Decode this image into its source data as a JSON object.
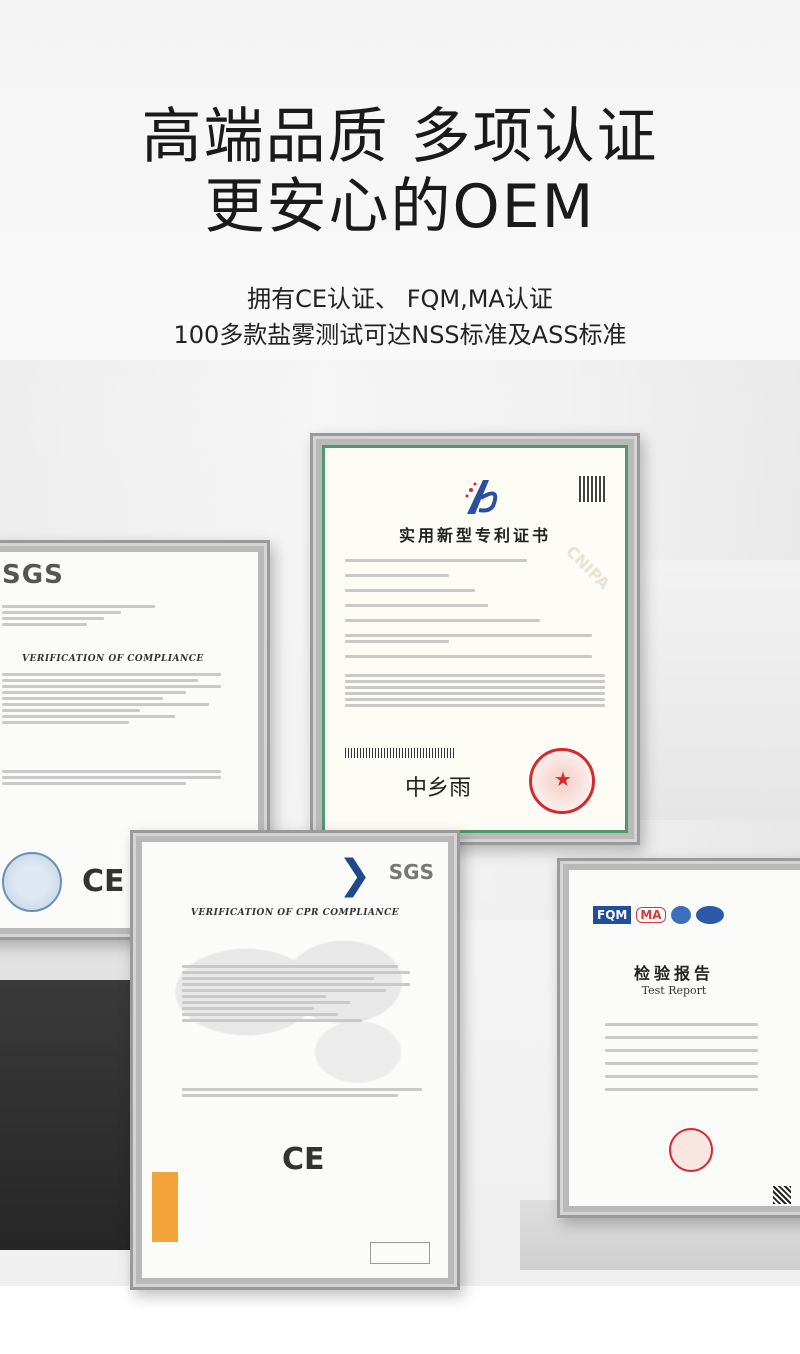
{
  "headline": {
    "line1": "高端品质 多项认证",
    "line2": "更安心的OEM"
  },
  "subline": {
    "line1": "拥有CE认证、 FQM,MA认证",
    "line2": "100多款盐雾测试可达NSS标准及ASS标准"
  },
  "certificates": {
    "sgs_compliance": {
      "brand": "SGS",
      "title": "VERIFICATION OF COMPLIANCE",
      "mark": "CE"
    },
    "cnipa_patent": {
      "title": "实用新型专利证书",
      "watermark": "CNIPA"
    },
    "sgs_cpr": {
      "brand": "SGS",
      "title": "VERIFICATION OF CPR COMPLIANCE",
      "mark": "CE"
    },
    "fqm_report": {
      "logo_fqm": "FQM",
      "logo_ma": "MA",
      "title_cn": "检验报告",
      "title_en": "Test Report"
    }
  },
  "colors": {
    "patent_border": "#4d9a6a",
    "seal_red": "#d62a2a",
    "fqm_blue": "#1f4e9c",
    "sgs_bird": "#21488a",
    "orange_block": "#f2a43b"
  }
}
